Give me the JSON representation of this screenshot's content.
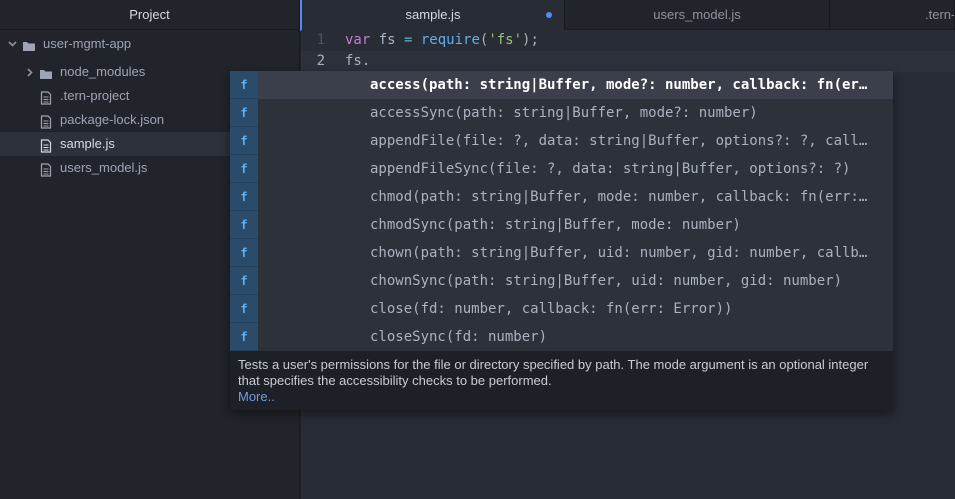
{
  "sidebar": {
    "title": "Project",
    "root": "user-mgmt-app",
    "items": [
      {
        "label": "node_modules",
        "type": "folder"
      },
      {
        "label": ".tern-project",
        "type": "file"
      },
      {
        "label": "package-lock.json",
        "type": "file"
      },
      {
        "label": "sample.js",
        "type": "file",
        "selected": true
      },
      {
        "label": "users_model.js",
        "type": "file"
      }
    ]
  },
  "tabs": [
    {
      "label": "sample.js",
      "active": true,
      "modified": true
    },
    {
      "label": "users_model.js",
      "active": false
    },
    {
      "label": ".tern-",
      "active": false
    }
  ],
  "editor": {
    "lines": [
      {
        "num": "1",
        "kw": "var",
        "name": " fs ",
        "op": "=",
        "fn": " require",
        "open": "(",
        "str": "'fs'",
        "close": ");"
      },
      {
        "num": "2",
        "text": "fs."
      }
    ]
  },
  "autocomplete": {
    "badge": "f",
    "items": [
      "access(path: string|Buffer, mode?: number, callback: fn(err: Error))",
      "accessSync(path: string|Buffer, mode?: number)",
      "appendFile(file: ?, data: string|Buffer, options?: ?, callback: fn(err: Error))",
      "appendFileSync(file: ?, data: string|Buffer, options?: ?)",
      "chmod(path: string|Buffer, mode: number, callback: fn(err: Error))",
      "chmodSync(path: string|Buffer, mode: number)",
      "chown(path: string|Buffer, uid: number, gid: number, callback: fn(err: Error))",
      "chownSync(path: string|Buffer, uid: number, gid: number)",
      "close(fd: number, callback: fn(err: Error))",
      "closeSync(fd: number)"
    ],
    "description": "Tests a user's permissions for the file or directory specified by path. The mode argument is an optional integer that specifies the accessibility checks to be performed.",
    "more_label": "More.."
  },
  "colors": {
    "accent": "#568af2",
    "sidebar_bg": "#21252b",
    "editor_bg": "#282c34",
    "keyword": "#c678dd",
    "string": "#98c379",
    "function": "#61afef"
  }
}
